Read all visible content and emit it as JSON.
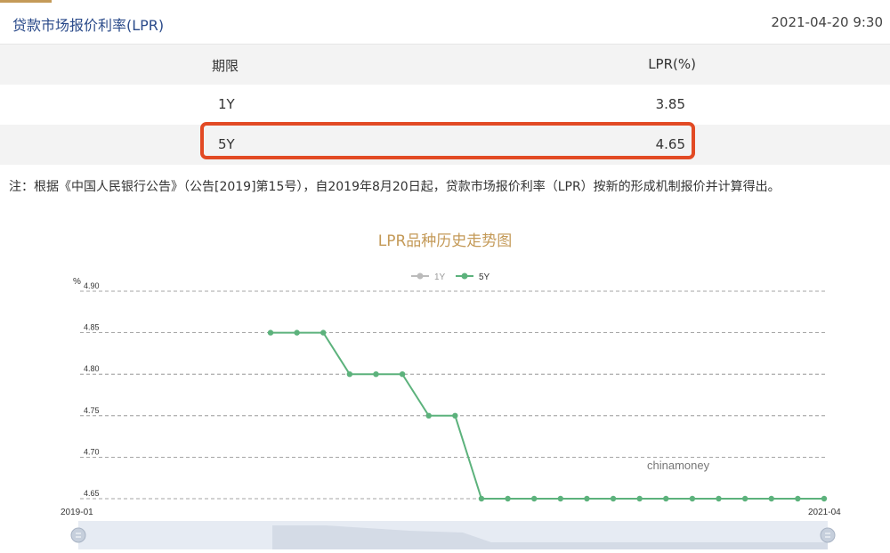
{
  "header": {
    "title": "贷款市场报价利率(LPR)",
    "datetime": "2021-04-20 9:30"
  },
  "table": {
    "headers": [
      "期限",
      "LPR(%)"
    ],
    "rows": [
      {
        "term": "1Y",
        "rate": "3.85"
      },
      {
        "term": "5Y",
        "rate": "4.65",
        "highlighted": true
      }
    ]
  },
  "note": "注：根据《中国人民银行公告》（公告[2019]第15号），自2019年8月20日起，贷款市场报价利率（LPR）按新的形成机制报价并计算得出。",
  "chart_title": "LPR品种历史走势图",
  "watermark": "chinamoney",
  "colors": {
    "title_blue": "#2a4a8a",
    "accent_gold": "#c49a58",
    "highlight_red": "#e24a24",
    "series_5y": "#5cb27c",
    "series_1y": "#bbbbbb"
  },
  "chart_data": {
    "type": "line",
    "ylabel": "%",
    "ylim": [
      4.65,
      4.9
    ],
    "yticks": [
      "4.90",
      "4.85",
      "4.80",
      "4.75",
      "4.70",
      "4.65"
    ],
    "x_start_label": "2019-01",
    "x_end_label": "2021-04",
    "legend": [
      "1Y",
      "5Y"
    ],
    "series": [
      {
        "name": "5Y",
        "values": [
          4.85,
          4.85,
          4.85,
          4.8,
          4.8,
          4.8,
          4.75,
          4.75,
          4.65,
          4.65,
          4.65,
          4.65,
          4.65,
          4.65,
          4.65,
          4.65,
          4.65,
          4.65,
          4.65,
          4.65,
          4.65,
          4.65
        ]
      }
    ]
  }
}
